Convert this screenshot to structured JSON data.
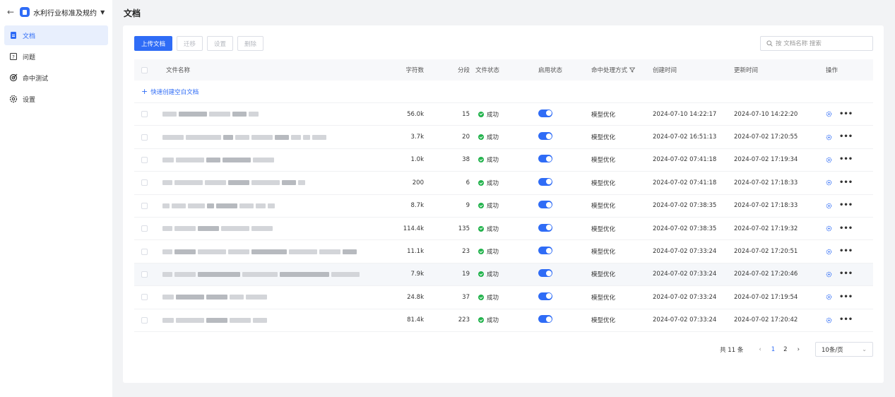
{
  "sidebar": {
    "kb_title": "水利行业标准及规约",
    "items": [
      {
        "label": "文档",
        "icon": "document-icon",
        "active": true
      },
      {
        "label": "问题",
        "icon": "question-icon",
        "active": false
      },
      {
        "label": "命中测试",
        "icon": "target-icon",
        "active": false
      },
      {
        "label": "设置",
        "icon": "gear-icon",
        "active": false
      }
    ]
  },
  "page": {
    "title": "文档"
  },
  "toolbar": {
    "upload_label": "上传文档",
    "migrate_label": "迁移",
    "settings_label": "设置",
    "delete_label": "删除"
  },
  "search": {
    "placeholder": "按 文档名称 搜索"
  },
  "table": {
    "headers": {
      "name": "文件名称",
      "chars": "字符数",
      "segments": "分段",
      "file_status": "文件状态",
      "enable_status": "启用状态",
      "hit_mode": "命中处理方式",
      "created": "创建时间",
      "updated": "更新时间",
      "ops": "操作"
    },
    "quick_create_label": "快速创建空白文档",
    "rows": [
      {
        "chars": "56.0k",
        "segments": "15",
        "status": "成功",
        "enabled": true,
        "mode": "模型优化",
        "created": "2024-07-10 14:22:17",
        "updated": "2024-07-10 14:22:20"
      },
      {
        "chars": "3.7k",
        "segments": "20",
        "status": "成功",
        "enabled": true,
        "mode": "模型优化",
        "created": "2024-07-02 16:51:13",
        "updated": "2024-07-02 17:20:55"
      },
      {
        "chars": "1.0k",
        "segments": "38",
        "status": "成功",
        "enabled": true,
        "mode": "模型优化",
        "created": "2024-07-02 07:41:18",
        "updated": "2024-07-02 17:19:34"
      },
      {
        "chars": "200",
        "segments": "6",
        "status": "成功",
        "enabled": true,
        "mode": "模型优化",
        "created": "2024-07-02 07:41:18",
        "updated": "2024-07-02 17:18:33"
      },
      {
        "chars": "8.7k",
        "segments": "9",
        "status": "成功",
        "enabled": true,
        "mode": "模型优化",
        "created": "2024-07-02 07:38:35",
        "updated": "2024-07-02 17:18:33"
      },
      {
        "chars": "114.4k",
        "segments": "135",
        "status": "成功",
        "enabled": true,
        "mode": "模型优化",
        "created": "2024-07-02 07:38:35",
        "updated": "2024-07-02 17:19:32"
      },
      {
        "chars": "11.1k",
        "segments": "23",
        "status": "成功",
        "enabled": true,
        "mode": "模型优化",
        "created": "2024-07-02 07:33:24",
        "updated": "2024-07-02 17:20:51"
      },
      {
        "chars": "7.9k",
        "segments": "19",
        "status": "成功",
        "enabled": true,
        "mode": "模型优化",
        "created": "2024-07-02 07:33:24",
        "updated": "2024-07-02 17:20:46"
      },
      {
        "chars": "24.8k",
        "segments": "37",
        "status": "成功",
        "enabled": true,
        "mode": "模型优化",
        "created": "2024-07-02 07:33:24",
        "updated": "2024-07-02 17:19:54"
      },
      {
        "chars": "81.4k",
        "segments": "223",
        "status": "成功",
        "enabled": true,
        "mode": "模型优化",
        "created": "2024-07-02 07:33:24",
        "updated": "2024-07-02 17:20:42"
      }
    ]
  },
  "pagination": {
    "total_label": "共 11 条",
    "prev": "‹",
    "next": "›",
    "pages": [
      "1",
      "2"
    ],
    "current": "1",
    "page_size": "10条/页"
  },
  "colors": {
    "accent": "#2f6cf6",
    "success": "#22b34c"
  }
}
